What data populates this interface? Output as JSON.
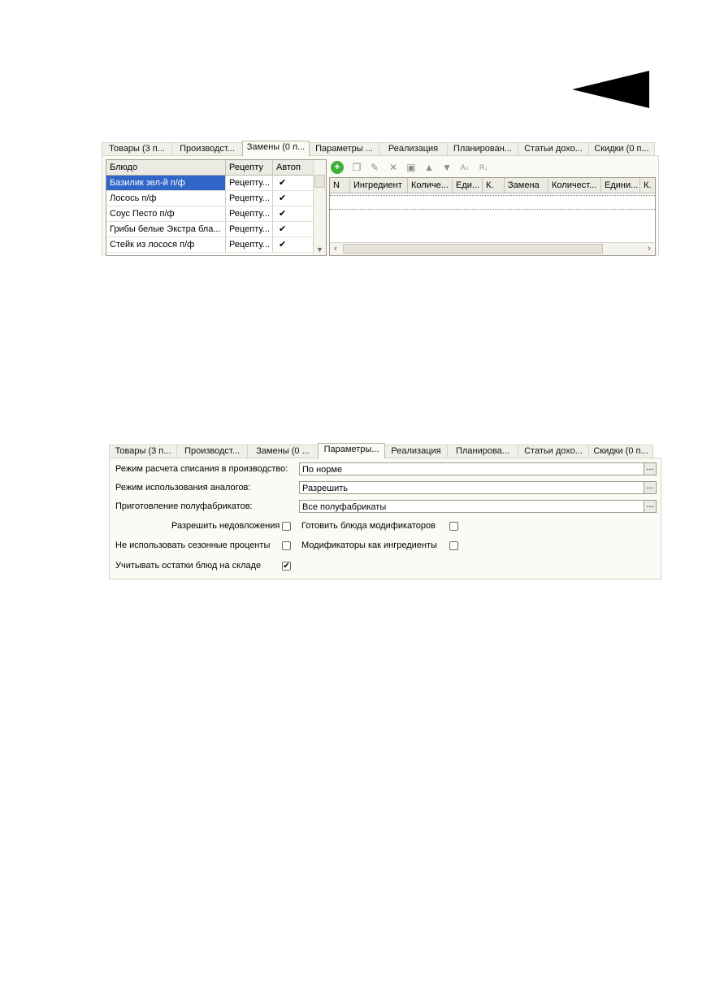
{
  "panel1": {
    "tabs": [
      {
        "label": "Товары (3 п..."
      },
      {
        "label": "Производст..."
      },
      {
        "label": "Замены (0 п..."
      },
      {
        "label": "Параметры ..."
      },
      {
        "label": "Реализация"
      },
      {
        "label": "Планирован..."
      },
      {
        "label": "Статьи дохо..."
      },
      {
        "label": "Скидки (0 п..."
      }
    ],
    "active_tab": 2,
    "left_grid": {
      "headers": [
        "Блюдо",
        "Рецепту",
        "Автоп"
      ],
      "rows": [
        {
          "dish": "Базилик зел-й п/ф",
          "recipe": "Рецепту...",
          "auto": "✔",
          "selected": true
        },
        {
          "dish": "Лосось п/ф",
          "recipe": "Рецепту...",
          "auto": "✔"
        },
        {
          "dish": "Соус Песто п/ф",
          "recipe": "Рецепту...",
          "auto": "✔"
        },
        {
          "dish": "Грибы белые Экстра бла...",
          "recipe": "Рецепту...",
          "auto": "✔"
        },
        {
          "dish": "Стейк из лосося п/ф",
          "recipe": "Рецепту...",
          "auto": "✔"
        }
      ]
    },
    "toolbar_icons": [
      "add-icon",
      "copy-icon",
      "edit-icon",
      "delete-icon",
      "save-icon",
      "move-up-icon",
      "move-down-icon",
      "sort-asc-icon",
      "sort-desc-icon"
    ],
    "right_grid": {
      "headers": [
        "N",
        "Ингредиент",
        "Количе...",
        "Еди...",
        "К.",
        "Замена",
        "Количест...",
        "Едини...",
        "К."
      ]
    }
  },
  "panel2": {
    "tabs": [
      {
        "label": "Товары (3 п..."
      },
      {
        "label": "Производст..."
      },
      {
        "label": "Замены (0 ..."
      },
      {
        "label": "Параметры..."
      },
      {
        "label": "Реализация"
      },
      {
        "label": "Планирова..."
      },
      {
        "label": "Статьи дохо..."
      },
      {
        "label": "Скидки (0 п..."
      }
    ],
    "active_tab": 3,
    "fields": [
      {
        "label": "Режим расчета списания в производство:",
        "value": "По норме"
      },
      {
        "label": "Режим использования аналогов:",
        "value": "Разрешить"
      },
      {
        "label": "Приготовление полуфабрикатов:",
        "value": "Все полуфабрикаты"
      }
    ],
    "dots_label": "...",
    "checkboxes": {
      "allow_shortage": {
        "label": "Разрешить недовложения",
        "checked": false
      },
      "cook_modifiers": {
        "label": "Готовить блюда модификаторов",
        "checked": false
      },
      "no_seasonal": {
        "label": "Не использовать сезонные проценты",
        "checked": false
      },
      "modifiers_as_ingredients": {
        "label": "Модификаторы как ингредиенты",
        "checked": false
      },
      "consider_stock": {
        "label": "Учитывать остатки блюд на складе",
        "checked": true
      }
    }
  },
  "check_glyph": "✔"
}
